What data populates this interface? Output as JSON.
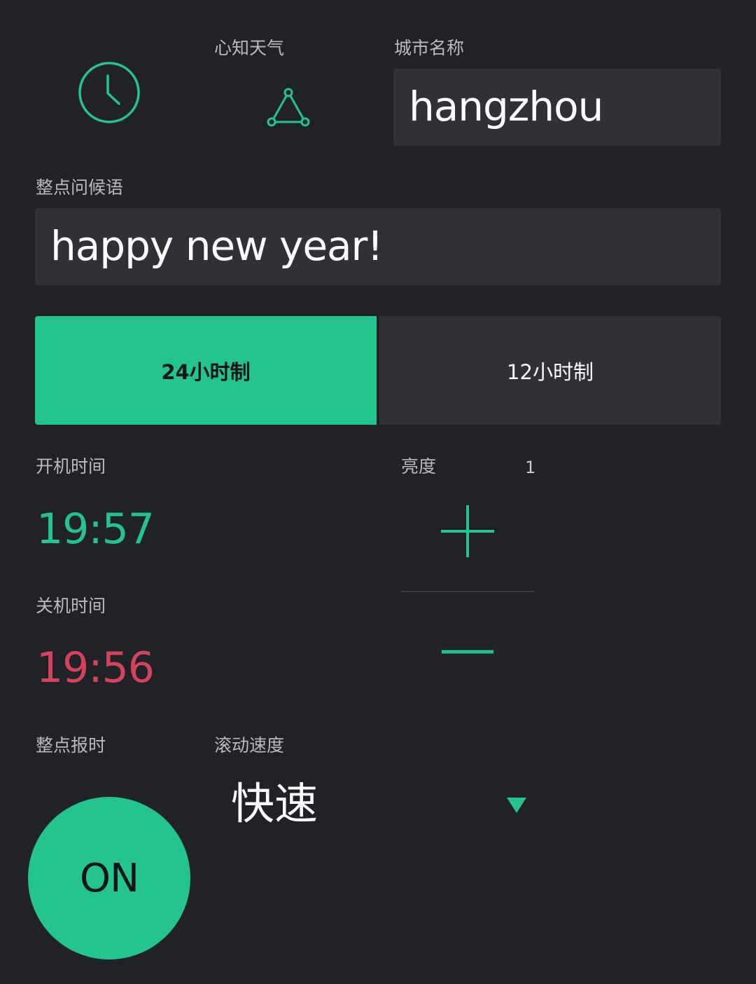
{
  "colors": {
    "background": "#212227",
    "field_bg": "#303136",
    "accent_green": "#23c48e",
    "accent_red": "#d3435c",
    "label_gray": "#b9bbbf"
  },
  "header": {
    "clock_icon": "clock-icon",
    "webhook_label": "心知天气",
    "webhook_icon": "webhook-icon"
  },
  "city": {
    "label": "城市名称",
    "value": "hangzhou"
  },
  "greeting": {
    "label": "整点问候语",
    "value": "happy new year!"
  },
  "time_format": {
    "options": [
      "24小时制",
      "12小时制"
    ],
    "selected_index": 0
  },
  "power_on": {
    "label": "开机时间",
    "time": "19:57"
  },
  "power_off": {
    "label": "关机时间",
    "time": "19:56"
  },
  "brightness": {
    "label": "亮度",
    "value": "1",
    "plus_icon": "plus-icon",
    "minus_icon": "minus-icon"
  },
  "hourly_chime": {
    "label": "整点报时",
    "button_label": "ON",
    "state": "on"
  },
  "scroll_speed": {
    "label": "滚动速度",
    "selected": "快速",
    "arrow_icon": "dropdown-arrow-icon"
  }
}
